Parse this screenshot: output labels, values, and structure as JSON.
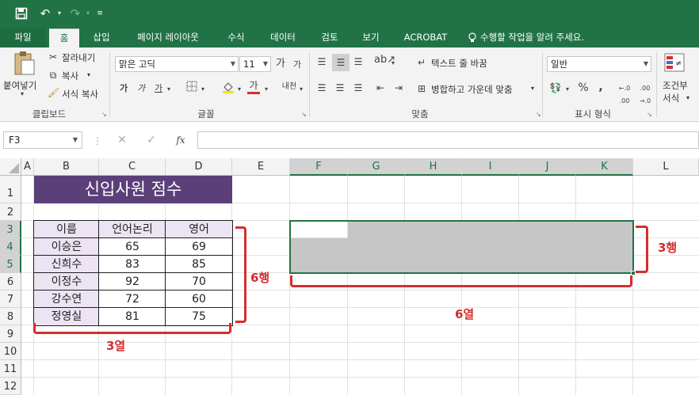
{
  "qat": {
    "save_icon": "save-icon",
    "undo_icon": "undo-icon",
    "redo_icon": "redo-icon",
    "customize_icon": "customize-icon"
  },
  "tabs": {
    "file": "파일",
    "home": "홈",
    "insert": "삽입",
    "page_layout": "페이지 레이아웃",
    "formulas": "수식",
    "data": "데이터",
    "review": "검토",
    "view": "보기",
    "acrobat": "ACROBAT"
  },
  "tell_me": "수행할 작업을 알려 주세요.",
  "ribbon": {
    "clipboard": {
      "paste": "붙여넣기",
      "cut": "잘라내기",
      "copy": "복사",
      "format_painter": "서식 복사",
      "label": "클립보드"
    },
    "font": {
      "name": "맑은 고딕",
      "size": "11",
      "label": "글꼴",
      "bold": "가",
      "italic": "가",
      "underline": "가",
      "font_color_glyph": "가",
      "phonetic": "내천",
      "grow": "가",
      "shrink": "가"
    },
    "alignment": {
      "wrap": "텍스트 줄 바꿈",
      "merge": "병합하고 가운데 맞춤",
      "label": "맞춤"
    },
    "number": {
      "format": "일반",
      "percent": "%",
      "comma": ",",
      "label": "표시 형식"
    },
    "styles": {
      "conditional_line1": "조건부",
      "conditional_line2": "서식"
    }
  },
  "formula_bar": {
    "name_box": "F3",
    "fx": "fx"
  },
  "columns": [
    "A",
    "B",
    "C",
    "D",
    "E",
    "F",
    "G",
    "H",
    "I",
    "J",
    "K",
    "L"
  ],
  "rows": [
    "1",
    "2",
    "3",
    "4",
    "5",
    "6",
    "7",
    "8",
    "9",
    "10",
    "11",
    "12"
  ],
  "sheet": {
    "title": "신입사원 점수",
    "headers": [
      "이름",
      "언어논리",
      "영어"
    ],
    "records": [
      [
        "이승은",
        "65",
        "69"
      ],
      [
        "신희수",
        "83",
        "85"
      ],
      [
        "이정수",
        "92",
        "70"
      ],
      [
        "강수연",
        "72",
        "60"
      ],
      [
        "정영실",
        "81",
        "75"
      ]
    ]
  },
  "annotations": {
    "rows_left": "6행",
    "cols_left": "3열",
    "rows_right": "3행",
    "cols_right": "6열"
  },
  "colors": {
    "excel_green": "#217346",
    "title_fill": "#5b3f79",
    "header_fill": "#ece4f2",
    "annotation_red": "#d42e2e",
    "selection_gray": "#c6c6c6"
  }
}
